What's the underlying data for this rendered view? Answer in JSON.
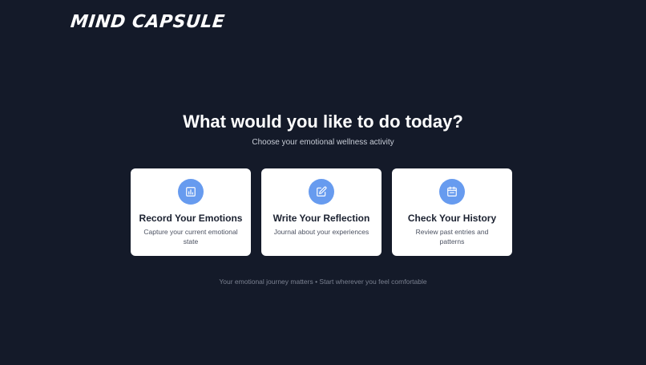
{
  "header": {
    "logo_text": "MIND CAPSULE"
  },
  "main": {
    "title": "What would you like to do today?",
    "subtitle": "Choose your emotional wellness activity"
  },
  "cards": [
    {
      "icon": "bar-chart-icon",
      "title": "Record Your Emotions",
      "description": "Capture your current emotional state"
    },
    {
      "icon": "edit-icon",
      "title": "Write Your Reflection",
      "description": "Journal about your experiences"
    },
    {
      "icon": "calendar-icon",
      "title": "Check Your History",
      "description": "Review past entries and patterns"
    }
  ],
  "footer": {
    "note": "Your emotional journey matters • Start wherever you feel comfortable"
  },
  "colors": {
    "background": "#141a29",
    "accent": "#679bef",
    "card_background": "#ffffff"
  }
}
